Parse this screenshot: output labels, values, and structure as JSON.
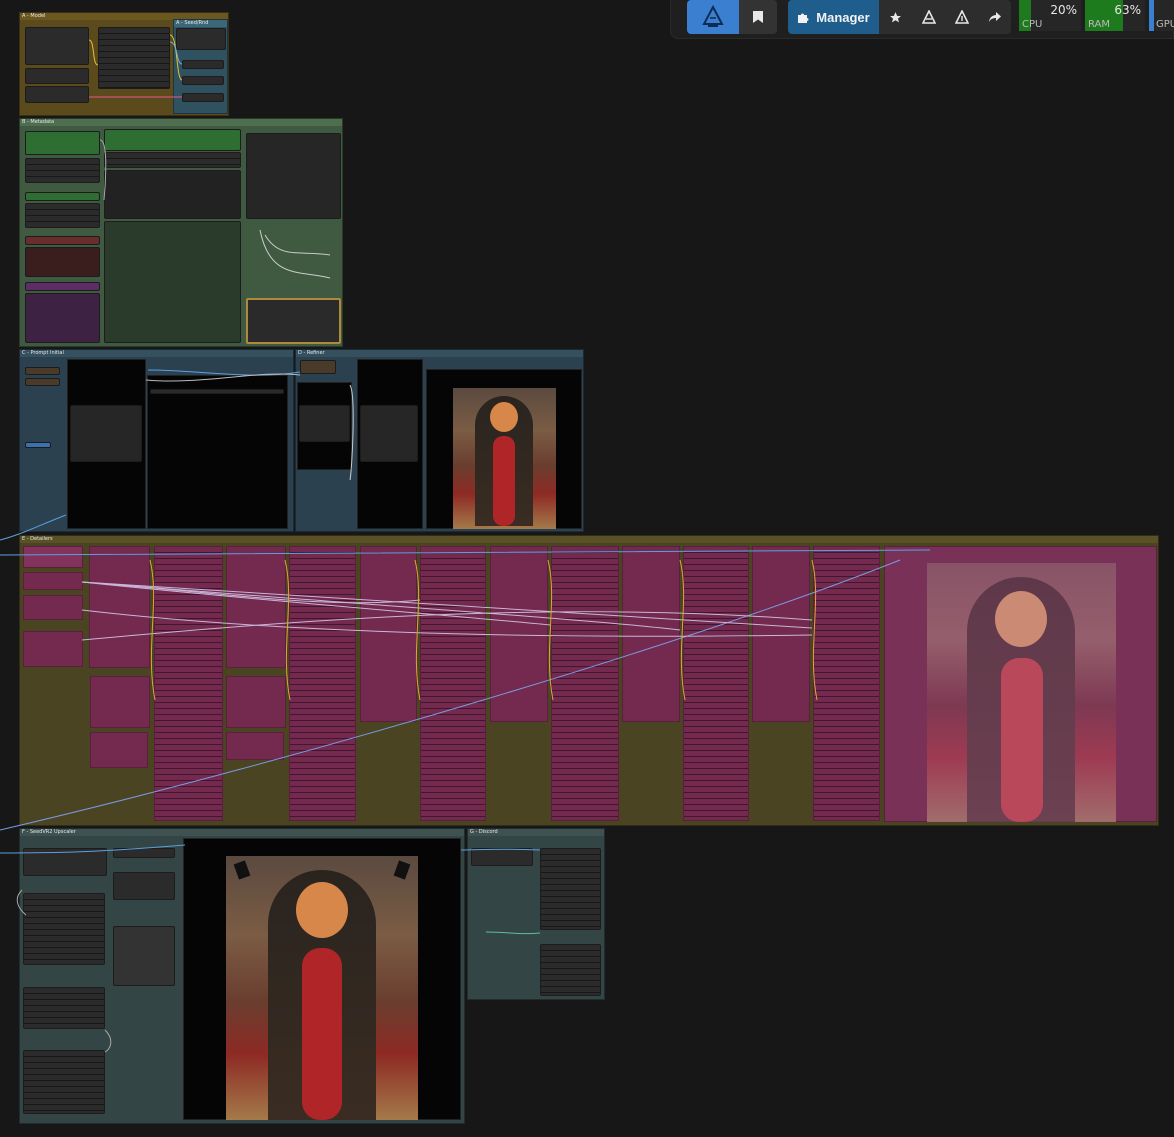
{
  "toolbar": {
    "manager_label": "Manager",
    "cpu": {
      "label": "CPU",
      "percent_text": "20%",
      "percent": 20
    },
    "ram": {
      "label": "RAM",
      "percent_text": "63%",
      "percent": 63
    },
    "gpu": {
      "label": "GPU"
    },
    "colors": {
      "accent_blue": "#3a7fd0",
      "manager_bg": "#1e5d8c",
      "meter_green": "#1d7a1d"
    }
  },
  "groups": {
    "model": "A - Model",
    "seed": "A - Seed/Rnd",
    "metadata": "B - Metadata",
    "prompt_initial": "C - Prompt Initial",
    "refiner": "D - Refiner",
    "detailers": "E - Detailers",
    "upscaler": "F - SeedVR2 Upscaler",
    "discord": "G - Discord"
  },
  "colors": {
    "group_model": "#5a4a1c",
    "group_metadata": "#3f5a40",
    "group_prompt": "#2c4150",
    "group_detailers": "#4a4422",
    "group_upscaler": "#344545",
    "node_pink": "#74294f"
  }
}
